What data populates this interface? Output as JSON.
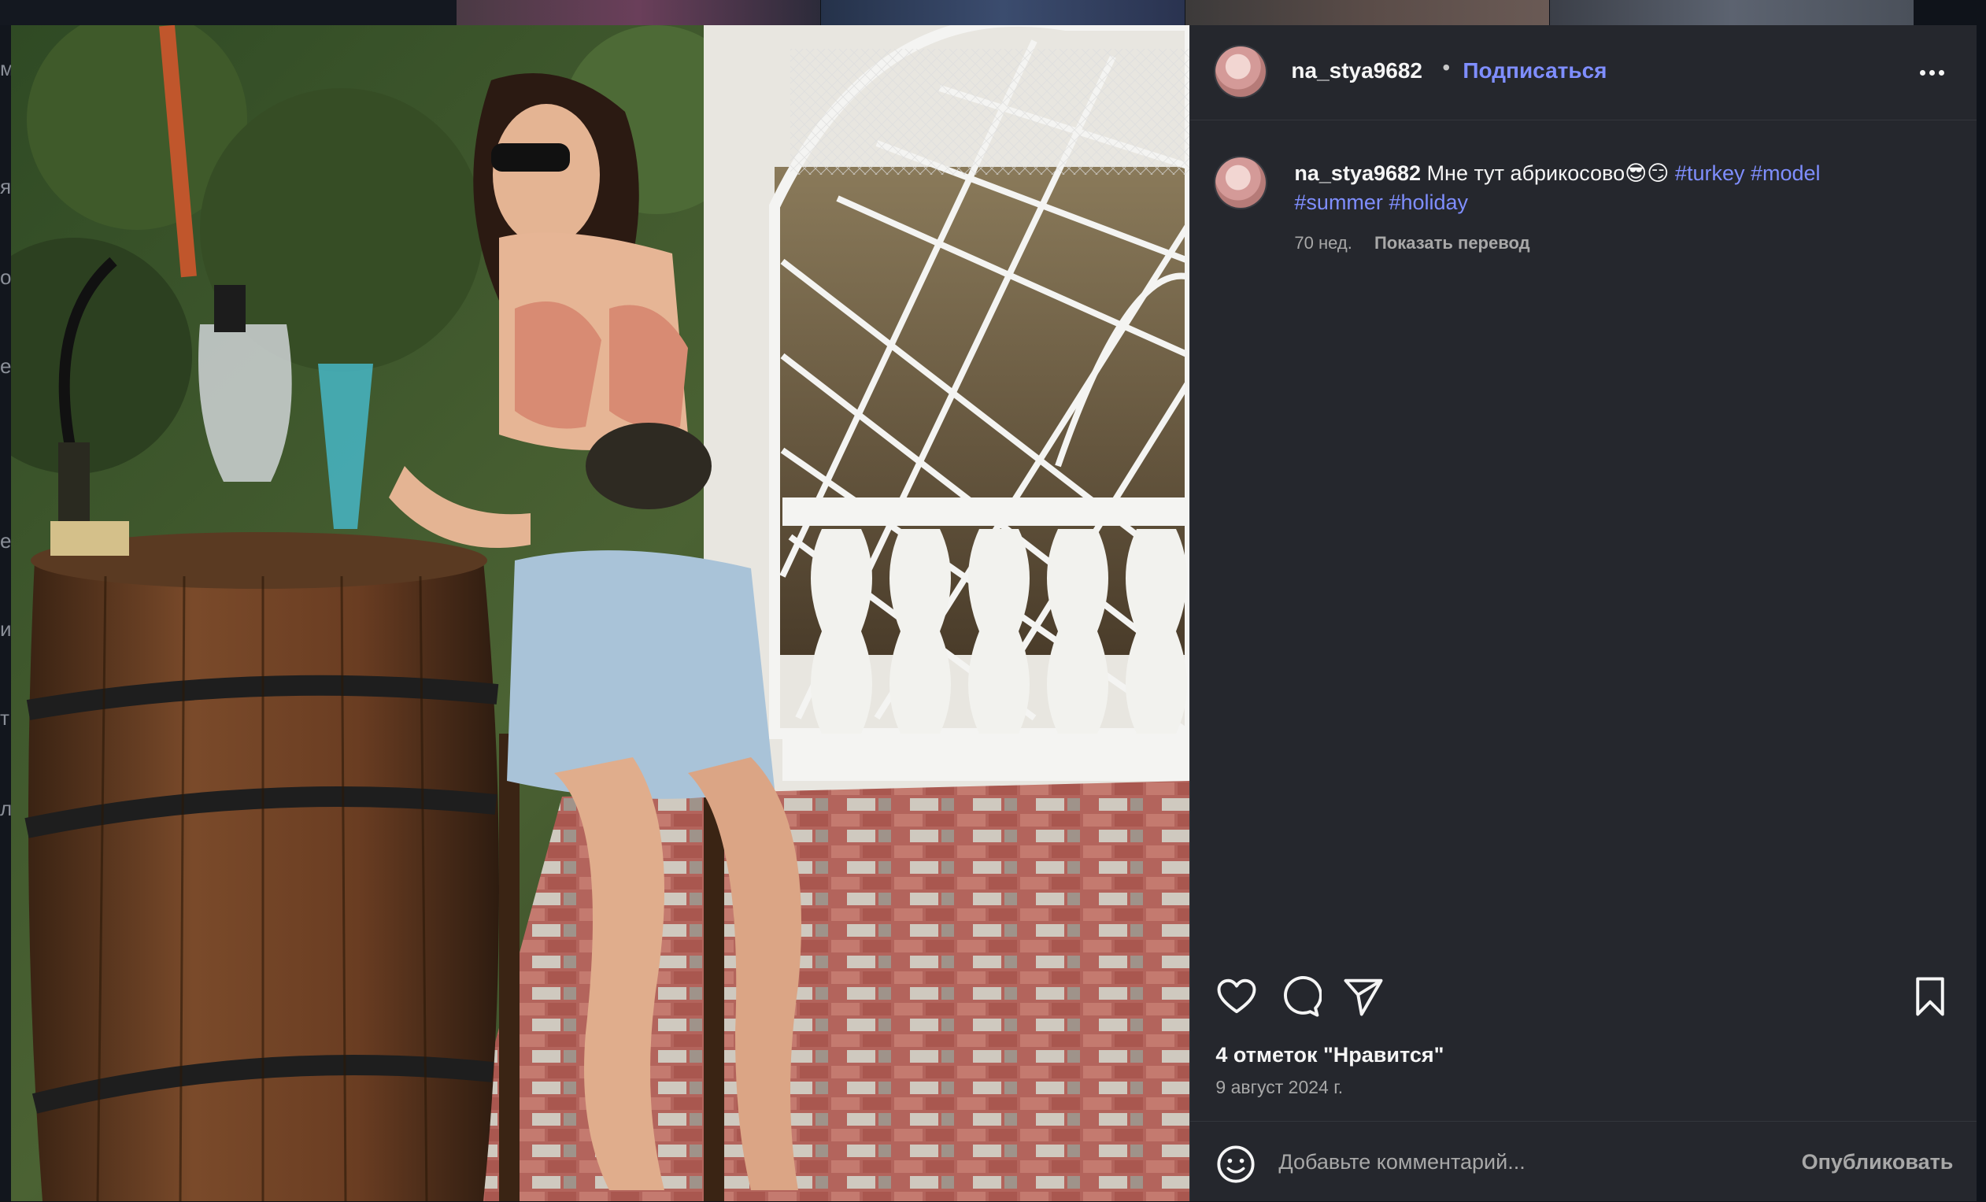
{
  "background": {
    "left_edge_letters": [
      "м",
      "я",
      "о",
      "е",
      "е",
      "и",
      "т",
      "л"
    ]
  },
  "post": {
    "username": "na_stya9682",
    "separator": "•",
    "follow_label": "Подписаться",
    "more_icon": "more-horizontal-icon",
    "caption": {
      "username": "na_stya9682",
      "text": "Мне тут абрикосово😎😏",
      "hashtags_line1": [
        "#turkey",
        "#model"
      ],
      "hashtags_line2": [
        "#summer",
        "#holiday"
      ],
      "age": "70 нед.",
      "translate_label": "Показать перевод"
    },
    "actions": {
      "like_icon": "heart-icon",
      "comment_icon": "comment-icon",
      "share_icon": "share-icon",
      "save_icon": "bookmark-icon"
    },
    "likes_text": "4 отметок \"Нравится\"",
    "date": "9 август 2024 г.",
    "comment": {
      "emoji_icon": "emoji-icon",
      "placeholder": "Добавьте комментарий...",
      "value": "",
      "publish_label": "Опубликовать"
    }
  },
  "colors": {
    "panel_bg": "#25272d",
    "link": "#7f8eff",
    "muted": "#a8a8a8",
    "text": "#f5f5f5"
  }
}
